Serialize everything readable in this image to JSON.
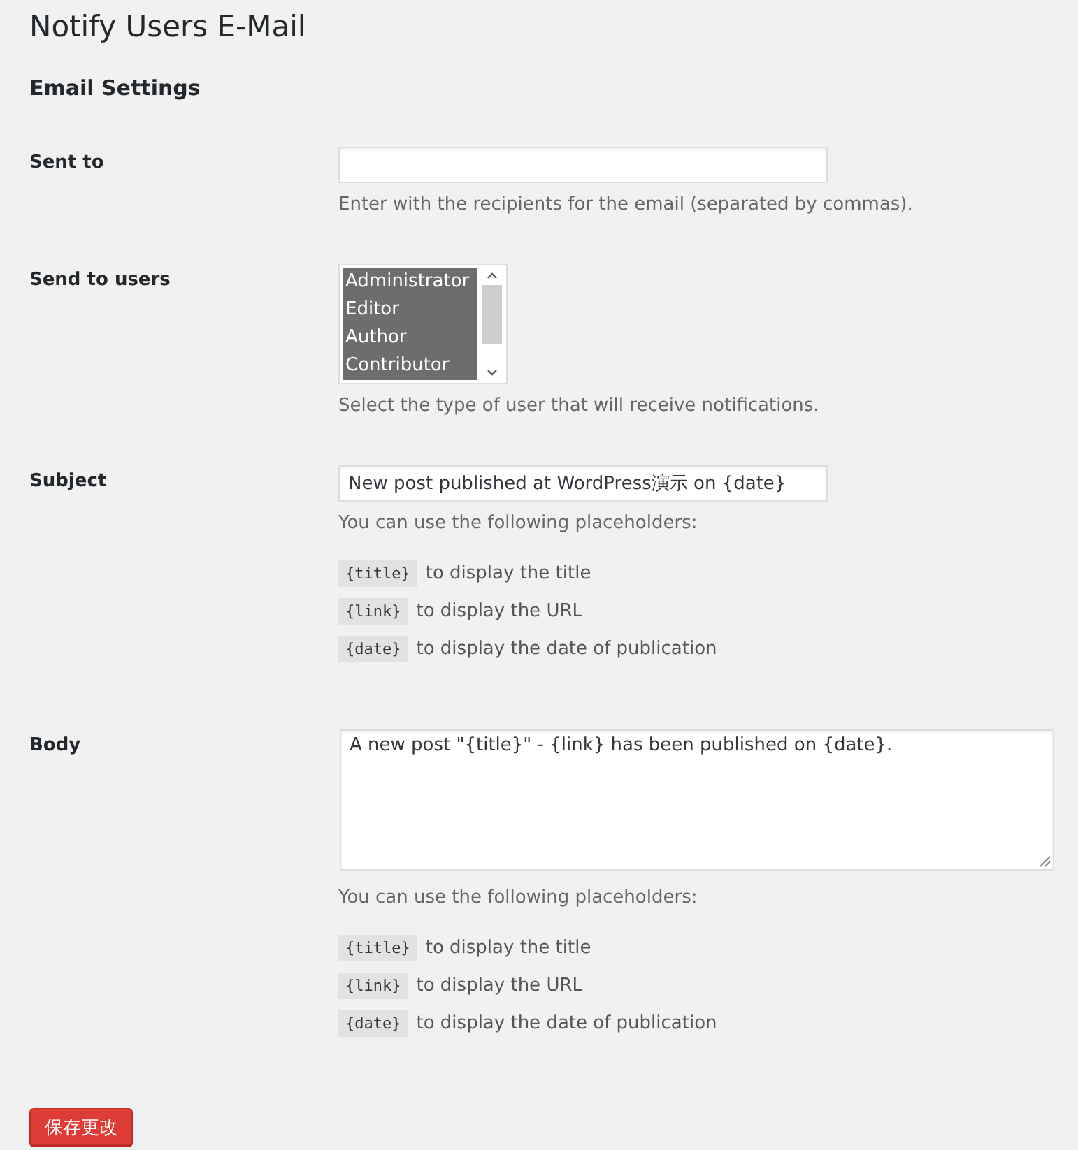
{
  "page_title": "Notify Users E-Mail",
  "section_title": "Email Settings",
  "fields": [
    {
      "kind": "text",
      "label": "Sent to",
      "description": "Enter with the recipients for the email (separated by commas)."
    },
    {
      "kind": "multiselect",
      "label": "Send to users",
      "options": [
        {
          "label": "Administrator",
          "selected": true
        },
        {
          "label": "Editor",
          "selected": true
        },
        {
          "label": "Author",
          "selected": true
        },
        {
          "label": "Contributor",
          "selected": true
        }
      ],
      "description": "Select the type of user that will receive notifications."
    },
    {
      "kind": "text",
      "label": "Subject",
      "value": "New post published at WordPress演示 on {date}",
      "description": "You can use the following placeholders:",
      "placeholder_tags": [
        {
          "tag": "{title}",
          "text": "to display the title"
        },
        {
          "tag": "{link}",
          "text": "to display the URL"
        },
        {
          "tag": "{date}",
          "text": "to display the date of publication"
        }
      ]
    },
    {
      "kind": "textarea",
      "label": "Body",
      "value": "A new post \"{title}\" - {link} has been published on {date}.",
      "description": "You can use the following placeholders:",
      "placeholder_tags": [
        {
          "tag": "{title}",
          "text": "to display the title"
        },
        {
          "tag": "{link}",
          "text": "to display the URL"
        },
        {
          "tag": "{date}",
          "text": "to display the date of publication"
        }
      ]
    }
  ],
  "save_button": "保存更改"
}
